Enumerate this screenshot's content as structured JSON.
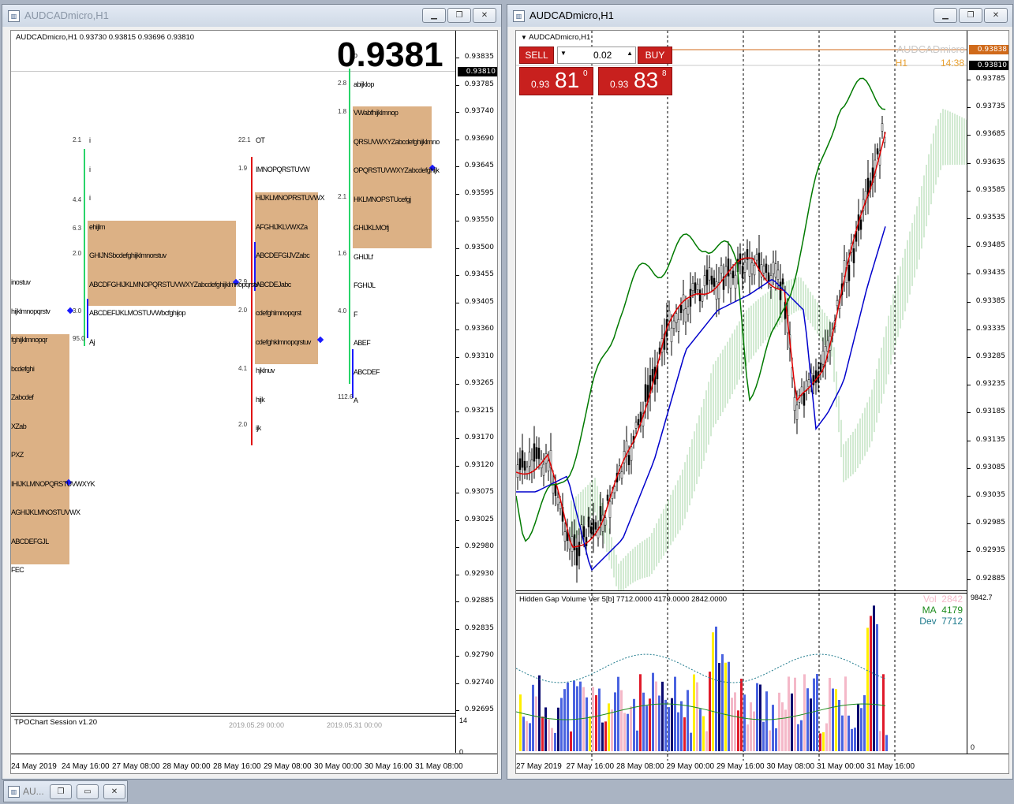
{
  "left_window": {
    "title": "AUDCADmicro,H1",
    "header": "AUDCADmicro,H1  0.93730 0.93815 0.93696 0.93810",
    "big_price": "0.9381",
    "current_price_label": "0.93810",
    "price_axis": [
      "0.93835",
      "0.93785",
      "0.93740",
      "0.93690",
      "0.93645",
      "0.93595",
      "0.93550",
      "0.93500",
      "0.93455",
      "0.93405",
      "0.93360",
      "0.93310",
      "0.93265",
      "0.93215",
      "0.93170",
      "0.93120",
      "0.93075",
      "0.93025",
      "0.92980",
      "0.92930",
      "0.92885",
      "0.92835",
      "0.92790",
      "0.92740",
      "0.92695"
    ],
    "time_axis": [
      "24 May 2019",
      "24 May 16:00",
      "27 May 08:00",
      "28 May 00:00",
      "28 May 16:00",
      "29 May 08:00",
      "30 May 00:00",
      "30 May 16:00",
      "31 May 08:00"
    ],
    "indicator_title": "TPOChart Session v1.20",
    "indicator_axis": [
      "14",
      "0"
    ],
    "session_labels": [
      "2019.05.29 00:00",
      "2019.05.31 00:00"
    ],
    "tpo": {
      "col1": [
        "inostuv",
        "hijklmnopqrstv",
        "fghijklmnopqr",
        "bcdefghi",
        "Zabcdef",
        "XZab",
        "PXZ",
        "IHIJKLMNOPQRSTUVWXYK",
        "AGHIJKLMNOSTUVWX",
        "ABCDEFGJL",
        "FEC"
      ],
      "col2": [
        "i",
        "i",
        "i",
        "ehijlm",
        "GHIJNSbcdefghijklmnorstuv",
        "ABCDFGHIJKLMNOPQRSTUVWXYZabcdefghijklmnopqrstv",
        "ABCDEFIJKLMOSTUVWbcfghijop",
        "Aj"
      ],
      "col2_nums": [
        "2.1",
        "4.4",
        "6.3",
        "2.0",
        "3.0",
        "95.0"
      ],
      "col3": [
        "OT",
        "IMNOPQRSTUVW",
        "HIJKLMNOPRSTUVWX",
        "AFGHIJKLVWXZa",
        "ABCDEFGIJVZabc",
        "ABCDEJabc",
        "cdefghlmnopqrst",
        "cdefghklmnopqrstuv",
        "hjklnuv",
        "hijk",
        "ijk"
      ],
      "col3_nums": [
        "22.1",
        "1.9",
        "2.9",
        "2.0",
        "4.1",
        "2.0"
      ],
      "col4": [
        "p",
        "abijklop",
        "VWabfhijklmnop",
        "QRSUVWXYZabcdefghijklmno",
        "OPQRSTUVWXYZabcdefghijk",
        "HKLMNOPSTUcefgj",
        "GHIJKLMOfj",
        "GHIJLf",
        "FGHIJL",
        "F",
        "ABEF",
        "ABCDEF",
        "A"
      ],
      "col4_nums": [
        "2.8",
        "1.8",
        "2.1",
        "1.6",
        "4.0",
        "112.6"
      ]
    }
  },
  "right_window": {
    "title": "AUDCADmicro,H1",
    "header": "AUDCADmicro,H1",
    "sell_label": "SELL",
    "buy_label": "BUY",
    "lot": "0.02",
    "sell_price_prefix": "0.93",
    "sell_price_big": "81",
    "sell_price_sup": "0",
    "buy_price_prefix": "0.93",
    "buy_price_big": "83",
    "buy_price_sup": "8",
    "watermark": "AUDCADmicro",
    "timeframe": "H1",
    "countdown": "14:38",
    "ask_label": "0.93838",
    "bid_label": "0.93810",
    "price_axis": [
      "0.93785",
      "0.93735",
      "0.93685",
      "0.93635",
      "0.93585",
      "0.93535",
      "0.93485",
      "0.93435",
      "0.93385",
      "0.93335",
      "0.93285",
      "0.93235",
      "0.93185",
      "0.93135",
      "0.93085",
      "0.93035",
      "0.92985",
      "0.92935",
      "0.92885"
    ],
    "time_axis": [
      "27 May 2019",
      "27 May 16:00",
      "28 May 08:00",
      "29 May 00:00",
      "29 May 16:00",
      "30 May 08:00",
      "31 May 00:00",
      "31 May 16:00"
    ],
    "volume_title": "Hidden Gap Volume Ver 5[b] 7712.0000 4179.0000 2842.0000",
    "vol_label": "Vol",
    "vol_value": "2842",
    "ma_label": "MA",
    "ma_value": "4179",
    "dev_label": "Dev",
    "dev_value": "7712",
    "volume_axis": [
      "9842.7",
      "0"
    ],
    "colors": {
      "tenkan": "#e00000",
      "kijun": "#0000cc",
      "chikou": "#007a00",
      "cloud": "#2a9a2a",
      "ask_line": "#d06a1a"
    }
  },
  "taskbar": {
    "label": "AU..."
  }
}
